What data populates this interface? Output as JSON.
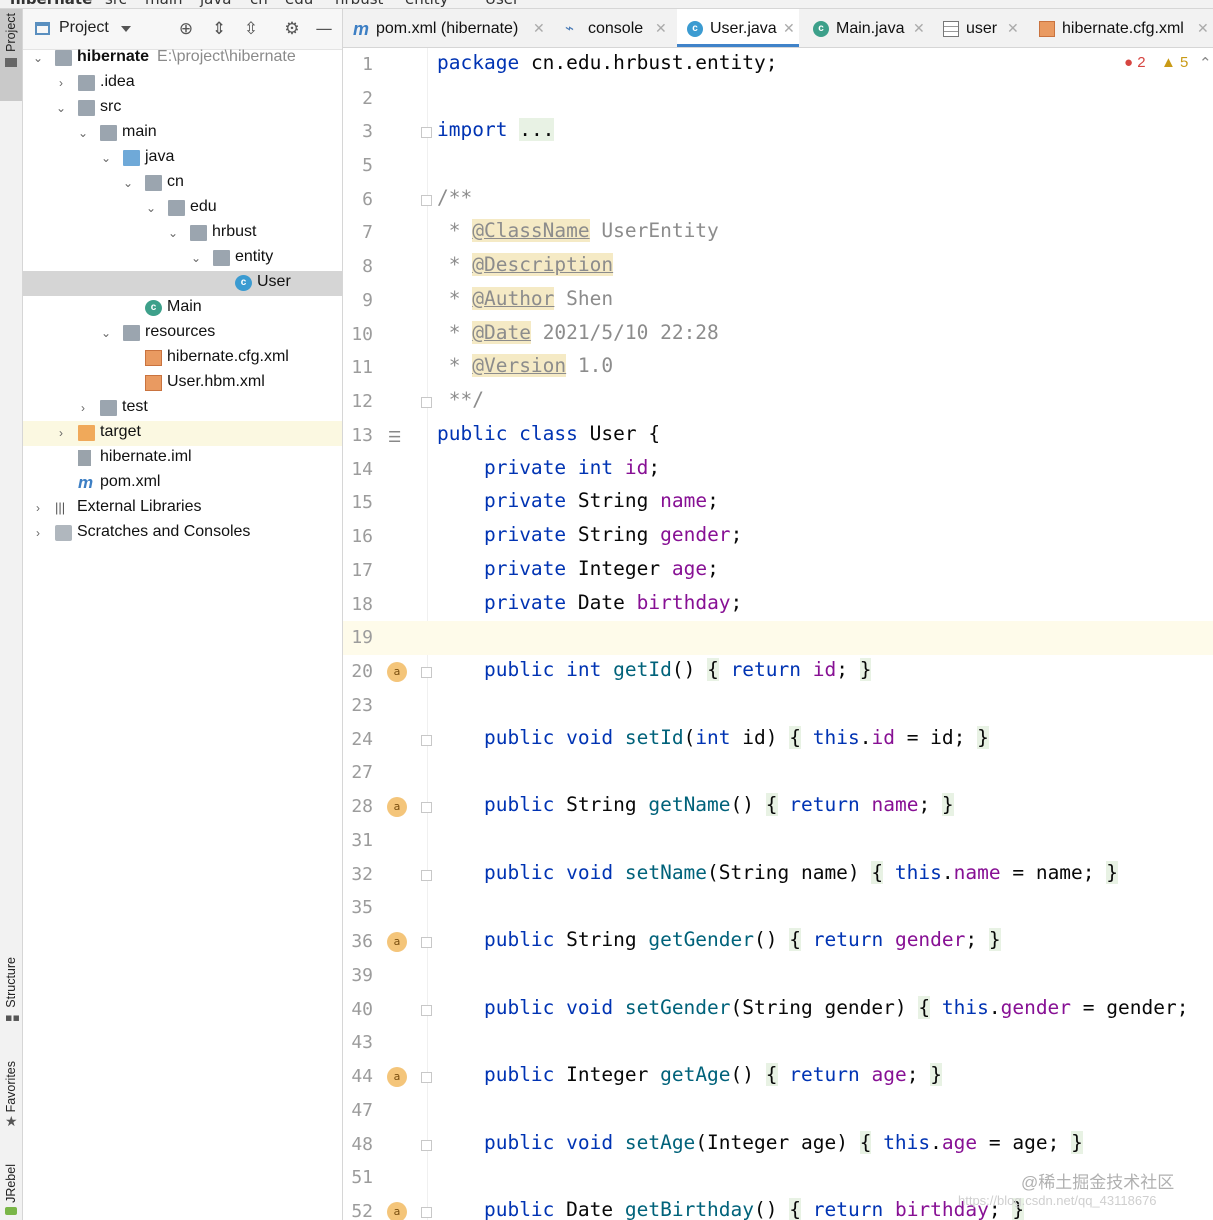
{
  "breadcrumb": [
    "hibernate",
    "src",
    "main",
    "java",
    "cn",
    "edu",
    "hrbust",
    "entity",
    "User"
  ],
  "side_tabs": {
    "project": "Project",
    "structure": "Structure",
    "favorites": "Favorites",
    "jrebel": "JRebel"
  },
  "project_panel": {
    "title": "Project",
    "root_name": "hibernate",
    "root_path": "E:\\project\\hibernate",
    "items": [
      {
        "label": ".idea"
      },
      {
        "label": "src"
      },
      {
        "label": "main"
      },
      {
        "label": "java"
      },
      {
        "label": "cn"
      },
      {
        "label": "edu"
      },
      {
        "label": "hrbust"
      },
      {
        "label": "entity"
      },
      {
        "label": "User"
      },
      {
        "label": "Main"
      },
      {
        "label": "resources"
      },
      {
        "label": "hibernate.cfg.xml"
      },
      {
        "label": "User.hbm.xml"
      },
      {
        "label": "test"
      },
      {
        "label": "target"
      },
      {
        "label": "hibernate.iml"
      },
      {
        "label": "pom.xml"
      },
      {
        "label": "External Libraries"
      },
      {
        "label": "Scratches and Consoles"
      }
    ]
  },
  "tabs": [
    {
      "label": "pom.xml (hibernate)",
      "icon": "maven-icon"
    },
    {
      "label": "console",
      "icon": "console-icon"
    },
    {
      "label": "User.java",
      "icon": "class-icon",
      "active": true
    },
    {
      "label": "Main.java",
      "icon": "class-run-icon"
    },
    {
      "label": "user",
      "icon": "table-icon"
    },
    {
      "label": "hibernate.cfg.xml",
      "icon": "xml-icon"
    }
  ],
  "inspections": {
    "errors": "2",
    "warnings": "5"
  },
  "editor": {
    "line_numbers": [
      "1",
      "2",
      "3",
      "5",
      "6",
      "7",
      "8",
      "9",
      "10",
      "11",
      "12",
      "13",
      "14",
      "15",
      "16",
      "17",
      "18",
      "19",
      "20",
      "23",
      "24",
      "27",
      "28",
      "31",
      "32",
      "35",
      "36",
      "39",
      "40",
      "43",
      "44",
      "47",
      "48",
      "51",
      "52"
    ],
    "code": {
      "package_kw": "package",
      "package_name": "cn.edu.hrbust.entity;",
      "import_kw": "import",
      "import_fold": "...",
      "doc_open": "/**",
      "tag_classname": "@ClassName",
      "val_classname": "UserEntity",
      "tag_description": "@Description",
      "tag_author": "@Author",
      "val_author": "Shen",
      "tag_date": "@Date",
      "val_date": "2021/5/10 22:28",
      "tag_version": "@Version",
      "val_version": "1.0",
      "doc_close": "**/",
      "class_decl": "User {",
      "fields": [
        {
          "type": "int",
          "name": "id"
        },
        {
          "type": "String",
          "name": "name"
        },
        {
          "type": "String",
          "name": "gender"
        },
        {
          "type": "Integer",
          "name": "age"
        },
        {
          "type": "Date",
          "name": "birthday"
        }
      ]
    }
  },
  "watermark": {
    "main": "@稀土掘金技术社区",
    "sub": "https://blog.csdn.net/qq_43118676"
  }
}
